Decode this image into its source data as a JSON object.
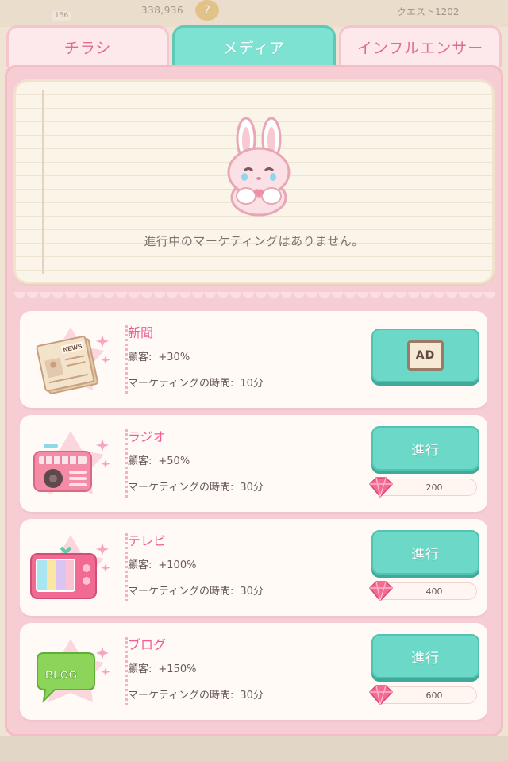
{
  "status_bar": {
    "level": "156",
    "coins": "338,936",
    "coin_icon": "?",
    "quest": "クエスト1202"
  },
  "tabs": [
    {
      "label": "チラシ",
      "active": false
    },
    {
      "label": "メディア",
      "active": true
    },
    {
      "label": "インフルエンサー",
      "active": false
    }
  ],
  "empty_state": {
    "message": "進行中のマーケティングはありません。"
  },
  "customers_label": "顧客:",
  "time_label": "マーケティングの時間:",
  "items": [
    {
      "name": "新聞",
      "customers": "+30%",
      "time": "10分",
      "action": "AD",
      "cost": null,
      "icon": "newspaper-icon"
    },
    {
      "name": "ラジオ",
      "customers": "+50%",
      "time": "30分",
      "action": "進行",
      "cost": "200",
      "icon": "radio-icon"
    },
    {
      "name": "テレビ",
      "customers": "+100%",
      "time": "30分",
      "action": "進行",
      "cost": "400",
      "icon": "tv-icon"
    },
    {
      "name": "ブログ",
      "customers": "+150%",
      "time": "30分",
      "action": "進行",
      "cost": "600",
      "icon": "blog-icon"
    }
  ],
  "blog_bubble_text": "BLOG",
  "newspaper_text": "NEWS",
  "colors": {
    "accent_mint": "#6cd9c8",
    "accent_pink": "#ee5e95",
    "panel_pink": "#f6cdd3"
  }
}
